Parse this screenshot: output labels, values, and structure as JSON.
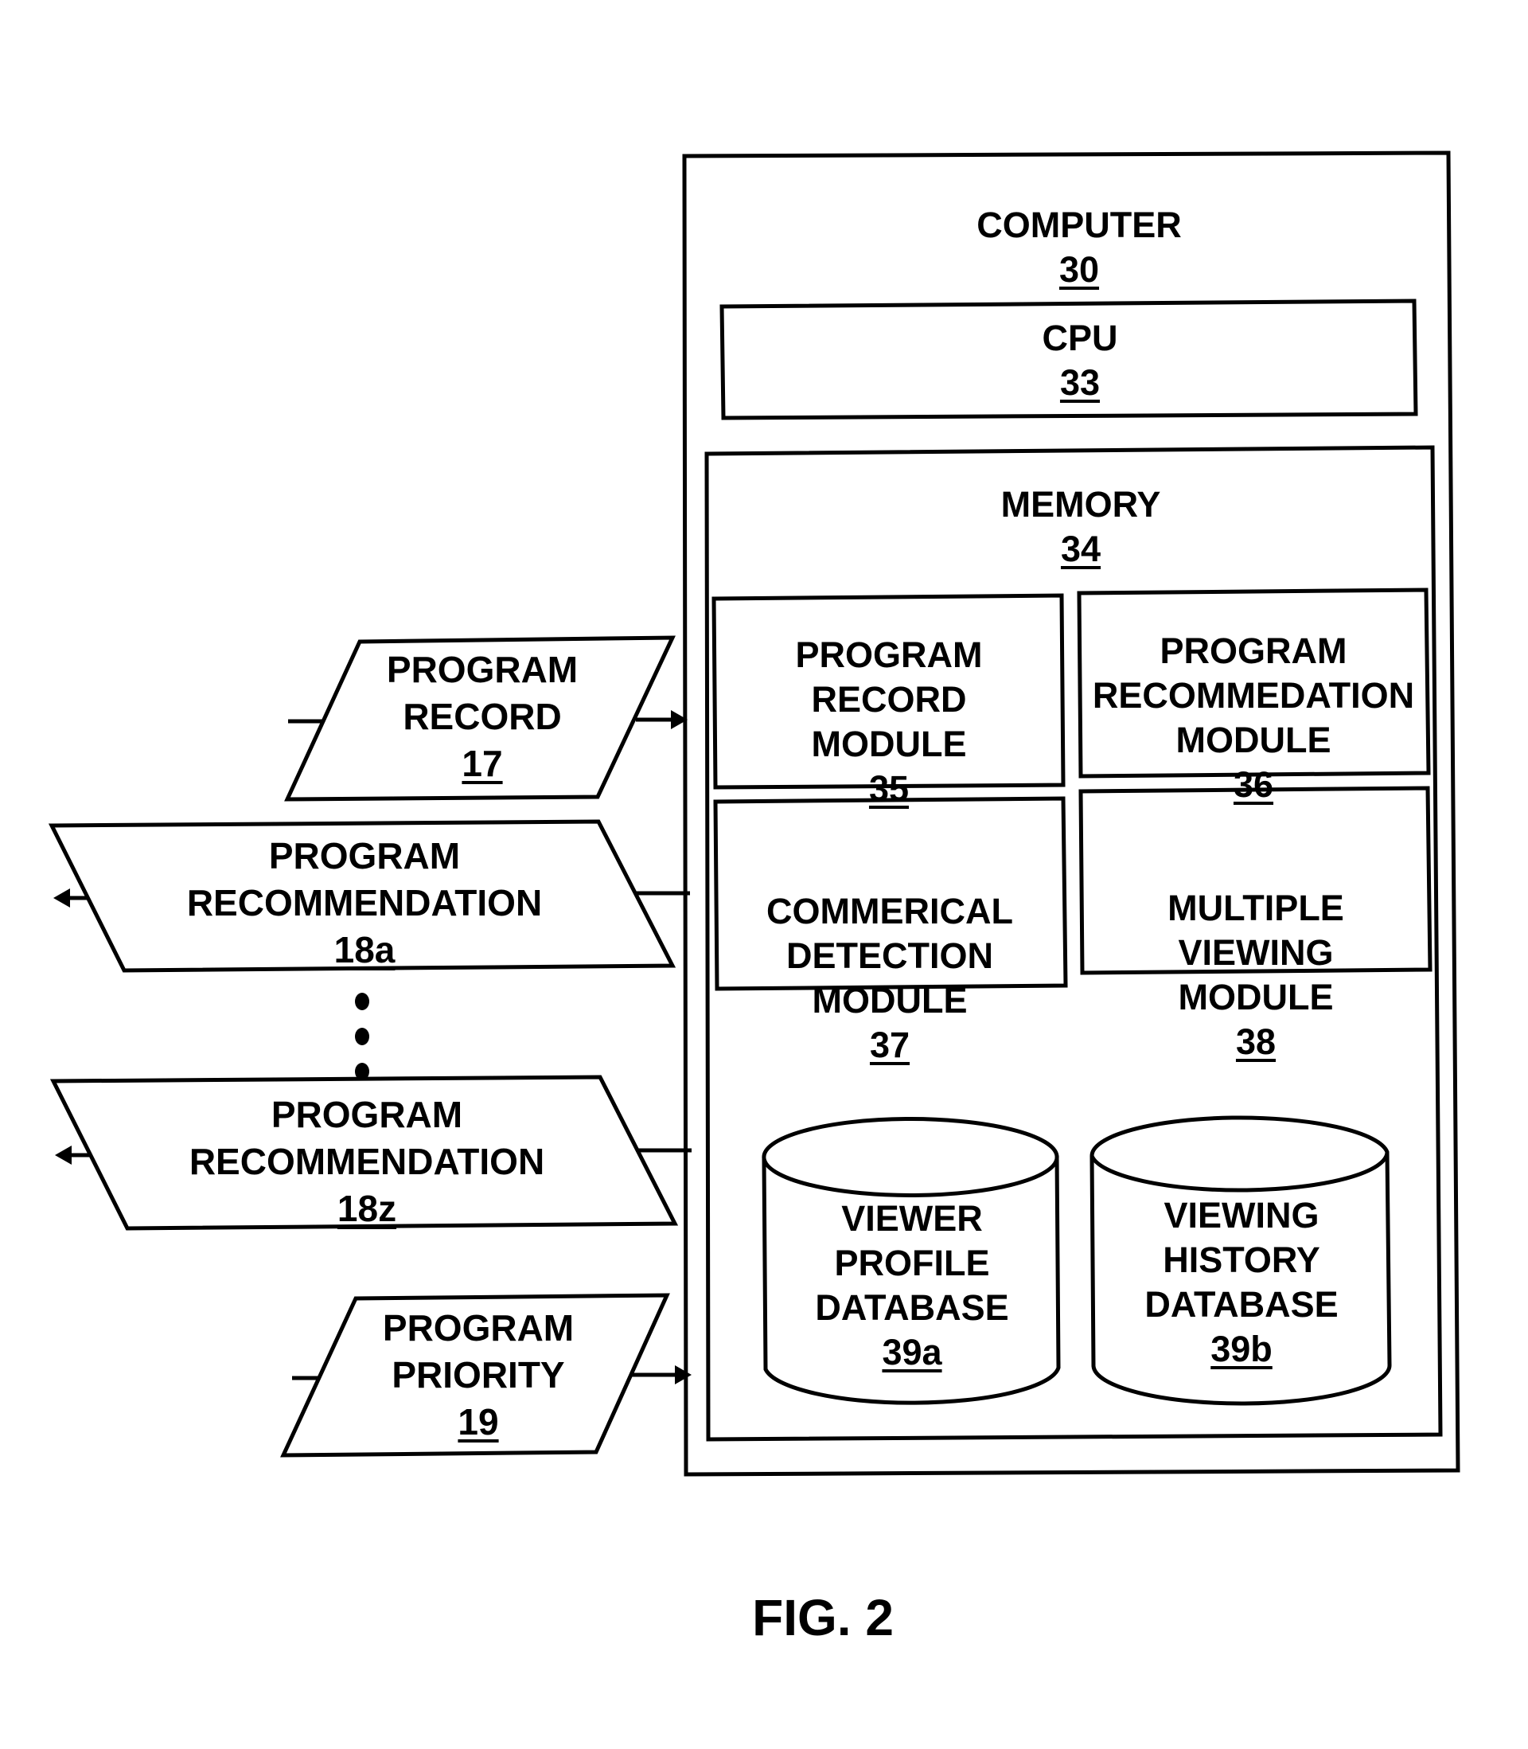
{
  "figure_label": "FIG. 2",
  "computer": {
    "title": "COMPUTER",
    "ref": "30"
  },
  "cpu": {
    "title": "CPU",
    "ref": "33"
  },
  "memory": {
    "title": "MEMORY",
    "ref": "34"
  },
  "modules": [
    {
      "lines": [
        "PROGRAM",
        "RECORD",
        "MODULE"
      ],
      "ref": "35"
    },
    {
      "lines": [
        "PROGRAM",
        "RECOMMEDATION",
        "MODULE"
      ],
      "ref": "36"
    },
    {
      "lines": [
        "COMMERICAL",
        "DETECTION",
        "MODULE"
      ],
      "ref": "37"
    },
    {
      "lines": [
        "MULTIPLE",
        "VIEWING",
        "MODULE"
      ],
      "ref": "38"
    }
  ],
  "databases": [
    {
      "lines": [
        "VIEWER",
        "PROFILE",
        "DATABASE"
      ],
      "ref": "39a"
    },
    {
      "lines": [
        "VIEWING",
        "HISTORY",
        "DATABASE"
      ],
      "ref": "39b"
    }
  ],
  "io": [
    {
      "lines": [
        "PROGRAM",
        "RECORD"
      ],
      "ref": "17",
      "direction": "input"
    },
    {
      "lines": [
        "PROGRAM",
        "RECOMMENDATION"
      ],
      "ref": "18a",
      "direction": "output"
    },
    {
      "lines": [
        "PROGRAM",
        "RECOMMENDATION"
      ],
      "ref": "18z",
      "direction": "output"
    },
    {
      "lines": [
        "PROGRAM",
        "PRIORITY"
      ],
      "ref": "19",
      "direction": "input"
    }
  ],
  "ellipsis_dots": 3
}
